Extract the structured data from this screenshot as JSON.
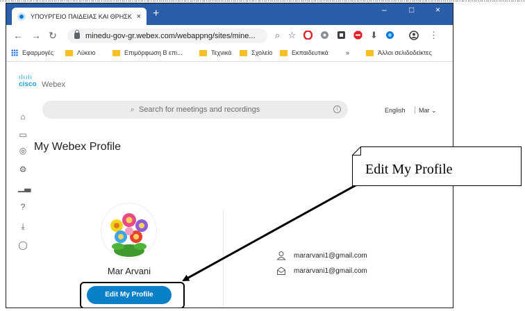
{
  "browser": {
    "tab_title": "ΥΠΟΥΡΓΕΙΟ ΠΑΙΔΕΙΑΣ ΚΑΙ ΘΡΗΣΚ",
    "tab_close": "×",
    "new_tab": "+",
    "url": "minedu-gov-gr.webex.com/webappng/sites/mine...",
    "window_controls": {
      "minimize": "–",
      "maximize": "□",
      "close": "×"
    },
    "bookmarks": [
      {
        "label": "Εφαρμογές",
        "icon": "apps-icon"
      },
      {
        "label": "Λύκειο",
        "icon": "folder-icon"
      },
      {
        "label": "Επιμόρφωση Β επι...",
        "icon": "folder-icon"
      },
      {
        "label": "Τεχνικά",
        "icon": "folder-icon"
      },
      {
        "label": "Σχολείο",
        "icon": "folder-icon"
      },
      {
        "label": "Εκπαιδευτικά",
        "icon": "folder-icon"
      },
      {
        "label": "»",
        "icon": ""
      },
      {
        "label": "Άλλοι σελιδοδείκτες",
        "icon": "folder-icon"
      }
    ]
  },
  "brand": {
    "logo_text": "cisco",
    "product": "Webex"
  },
  "search": {
    "placeholder": "Search for meetings and recordings"
  },
  "header": {
    "language": "English",
    "user_menu": "Mar"
  },
  "page": {
    "title": "My Webex Profile"
  },
  "profile": {
    "name": "Mar Arvani",
    "edit_button": "Edit My Profile",
    "emails": [
      "mararvani1@gmail.com",
      "mararvani1@gmail.com"
    ]
  },
  "annotation": {
    "callout_text": "Edit My Profile"
  },
  "colors": {
    "browser_frame": "#2b5ea8",
    "accent": "#0a80c8",
    "cisco": "#1ba0d7"
  }
}
